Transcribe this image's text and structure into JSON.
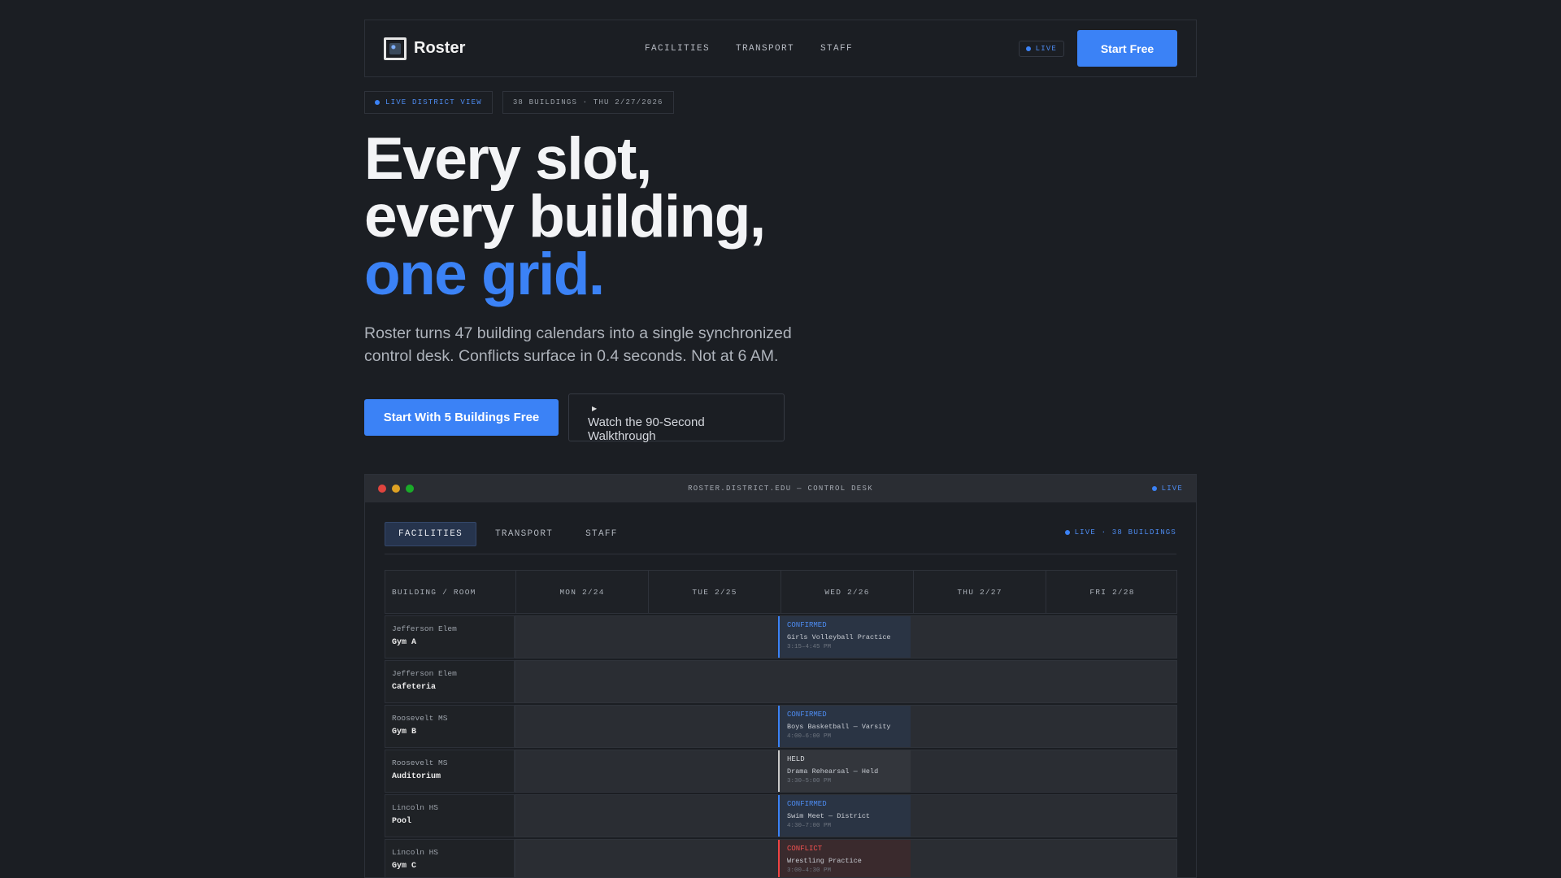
{
  "nav": {
    "brand": "Roster",
    "links": [
      "FACILITIES",
      "TRANSPORT",
      "STAFF"
    ],
    "live": "LIVE",
    "cta": "Start Free"
  },
  "badges": {
    "live_view": "LIVE DISTRICT VIEW",
    "meta": "38 BUILDINGS · THU 2/27/2026"
  },
  "hero": {
    "line1": "Every slot,",
    "line2": "every building,",
    "line3": "one grid.",
    "subtitle": "Roster turns 47 building calendars into a single synchronized control desk. Conflicts surface in 0.4 seconds. Not at 6 AM.",
    "cta_primary": "Start With 5 Buildings Free",
    "cta_secondary": "Watch the 90-Second Walkthrough"
  },
  "app": {
    "url": "ROSTER.DISTRICT.EDU — CONTROL DESK",
    "live": "LIVE",
    "tabs": [
      "FACILITIES",
      "TRANSPORT",
      "STAFF"
    ],
    "tabs_live": "LIVE · 38 BUILDINGS",
    "columns": [
      "BUILDING / ROOM",
      "MON 2/24",
      "TUE 2/25",
      "WED 2/26",
      "THU 2/27",
      "FRI 2/28"
    ],
    "rows": [
      {
        "building": "Jefferson Elem",
        "room": "Gym A",
        "event": {
          "status": "CONFIRMED",
          "name": "Girls Volleyball Practice",
          "time": "3:15–4:45 PM"
        }
      },
      {
        "building": "Jefferson Elem",
        "room": "Cafeteria",
        "event": null
      },
      {
        "building": "Roosevelt MS",
        "room": "Gym B",
        "event": {
          "status": "CONFIRMED",
          "name": "Boys Basketball — Varsity",
          "time": "4:00–6:00 PM"
        }
      },
      {
        "building": "Roosevelt MS",
        "room": "Auditorium",
        "event": {
          "status": "HELD",
          "name": "Drama Rehearsal — Held",
          "time": "3:30–5:00 PM"
        }
      },
      {
        "building": "Lincoln HS",
        "room": "Pool",
        "event": {
          "status": "CONFIRMED",
          "name": "Swim Meet — District",
          "time": "4:30–7:00 PM"
        }
      },
      {
        "building": "Lincoln HS",
        "room": "Gym C",
        "event": {
          "status": "CONFLICT",
          "name": "Wrestling Practice",
          "time": "3:00–4:30 PM"
        }
      }
    ]
  },
  "colors": {
    "accent": "#3b82f6",
    "background": "#1b1e23",
    "conflict": "#ef4444",
    "traffic_lights": [
      "#e0443e",
      "#dea123",
      "#1aab29"
    ]
  }
}
